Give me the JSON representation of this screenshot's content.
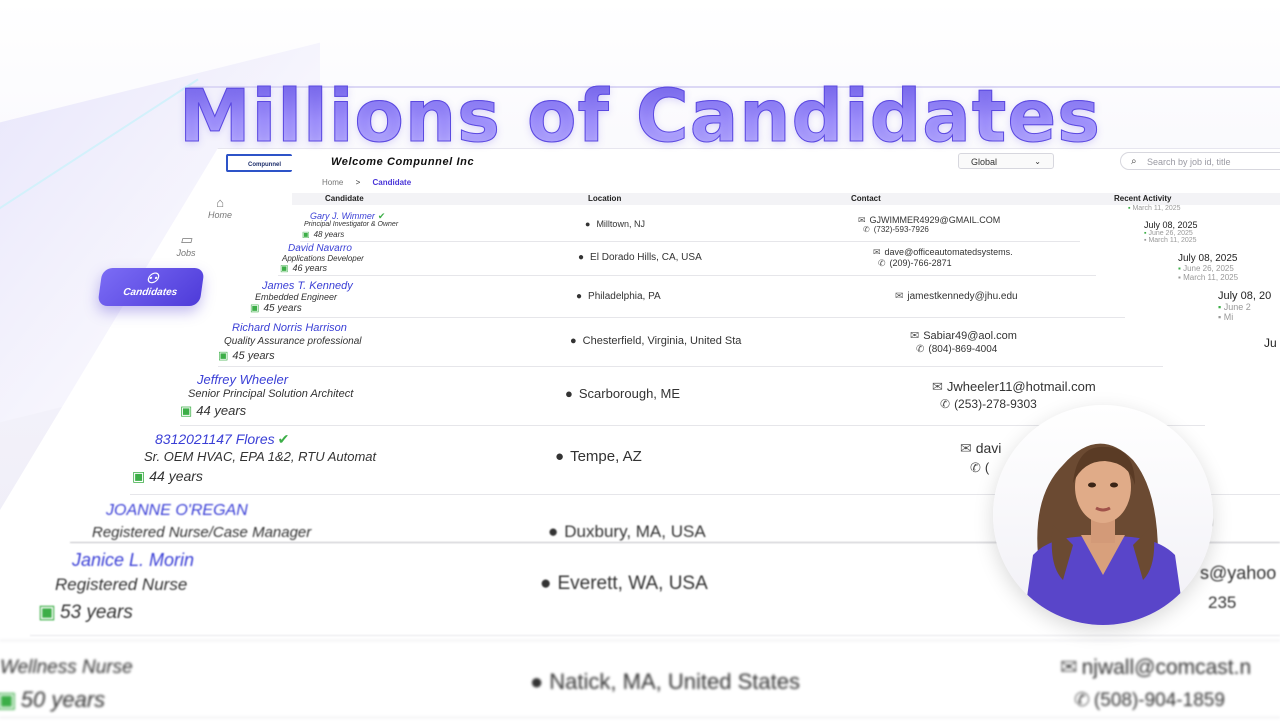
{
  "headline": "Millions of Candidates",
  "app": {
    "logo_text": "Compunnel",
    "welcome": "Welcome Compunnel Inc",
    "region_select": "Global",
    "search_placeholder": "Search by job id, title",
    "breadcrumb": {
      "home": "Home",
      "current": "Candidate"
    },
    "columns": {
      "candidate": "Candidate",
      "location": "Location",
      "contact": "Contact",
      "recent_activity": "Recent Activity"
    }
  },
  "sidebar": {
    "home": "Home",
    "jobs": "Jobs",
    "candidates": "Candidates"
  },
  "candidates": [
    {
      "name": "Gary J. Wimmer",
      "title": "Principal Investigator & Owner",
      "experience": "48 years",
      "location": "Milltown, NJ",
      "email": "GJWIMMER4929@GMAIL.COM",
      "phone": "(732)-593-7926"
    },
    {
      "name": "David Navarro",
      "title": "Applications Developer",
      "experience": "46 years",
      "location": "El Dorado Hills, CA, USA",
      "email": "dave@officeautomatedsystems.",
      "phone": "(209)-766-2871"
    },
    {
      "name": "James T. Kennedy",
      "title": "Embedded Engineer",
      "experience": "45 years",
      "location": "Philadelphia, PA",
      "email": "jamestkennedy@jhu.edu",
      "phone": ""
    },
    {
      "name": "Richard Norris Harrison",
      "title": "Quality Assurance professional",
      "experience": "45 years",
      "location": "Chesterfield, Virginia, United Sta",
      "email": "Sabiar49@aol.com",
      "phone": "(804)-869-4004"
    },
    {
      "name": "Jeffrey Wheeler",
      "title": "Senior Principal Solution Architect",
      "experience": "44 years",
      "location": "Scarborough, ME",
      "email": "Jwheeler11@hotmail.com",
      "phone": "(253)-278-9303"
    },
    {
      "name": "8312021147 Flores",
      "title": "Sr. OEM HVAC, EPA 1&2, RTU Automat",
      "experience": "44 years",
      "location": "Tempe, AZ",
      "email": "davi",
      "phone": "("
    },
    {
      "name": "JOANNE O'REGAN",
      "title": "Registered Nurse/Case Manager",
      "experience": "",
      "location": "Duxbury, MA, USA",
      "email": "m",
      "phone": ""
    },
    {
      "name": "Janice L. Morin",
      "title": "Registered Nurse",
      "experience": "53 years",
      "location": "Everett, WA, USA",
      "email": "s@yahoo",
      "phone": "235"
    },
    {
      "name": "",
      "title": "Wellness Nurse",
      "experience": "50 years",
      "location": "Natick, MA, United States",
      "email": "njwall@comcast.n",
      "phone": "(508)-904-1859"
    }
  ],
  "activity": [
    {
      "main": "",
      "sub1": "March 11, 2025",
      "sub2": ""
    },
    {
      "main": "July 08, 2025",
      "sub1": "June 26, 2025",
      "sub2": "March 11, 2025"
    },
    {
      "main": "July 08, 2025",
      "sub1": "June 26, 2025",
      "sub2": "March 11, 2025"
    },
    {
      "main": "July 08, 20",
      "sub1": "June 2",
      "sub2": "Mi"
    },
    {
      "main": "Ju",
      "sub1": "",
      "sub2": ""
    }
  ]
}
